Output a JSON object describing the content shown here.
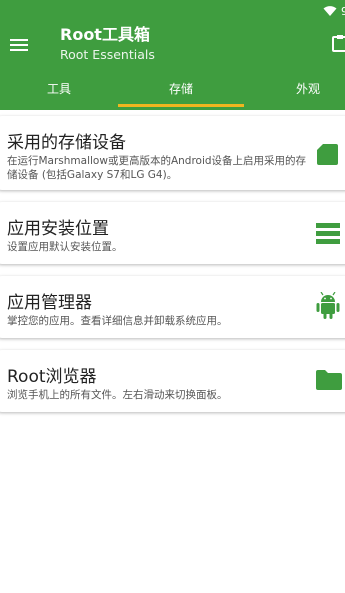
{
  "app": {
    "title": "Root工具箱",
    "subtitle": "Root Essentials"
  },
  "status": {
    "clock_partial": "9"
  },
  "tabs": [
    {
      "label": "工具",
      "active": false
    },
    {
      "label": "存储",
      "active": true
    },
    {
      "label": "外观",
      "active": false
    }
  ],
  "colors": {
    "primary": "#3f9d3f",
    "accent": "#f0b61f"
  },
  "items": [
    {
      "title": "采用的存储设备",
      "desc": "在运行Marshmallow或更高版本的Android设备上启用采用的存储设备 (包括Galaxy S7和LG G4)。",
      "icon": "sd-card-icon"
    },
    {
      "title": "应用安装位置",
      "desc": "设置应用默认安装位置。",
      "icon": "list-icon"
    },
    {
      "title": "应用管理器",
      "desc": "掌控您的应用。查看详细信息并卸载系统应用。",
      "icon": "android-icon"
    },
    {
      "title": "Root浏览器",
      "desc": "浏览手机上的所有文件。左右滑动来切换面板。",
      "icon": "folder-icon"
    }
  ]
}
